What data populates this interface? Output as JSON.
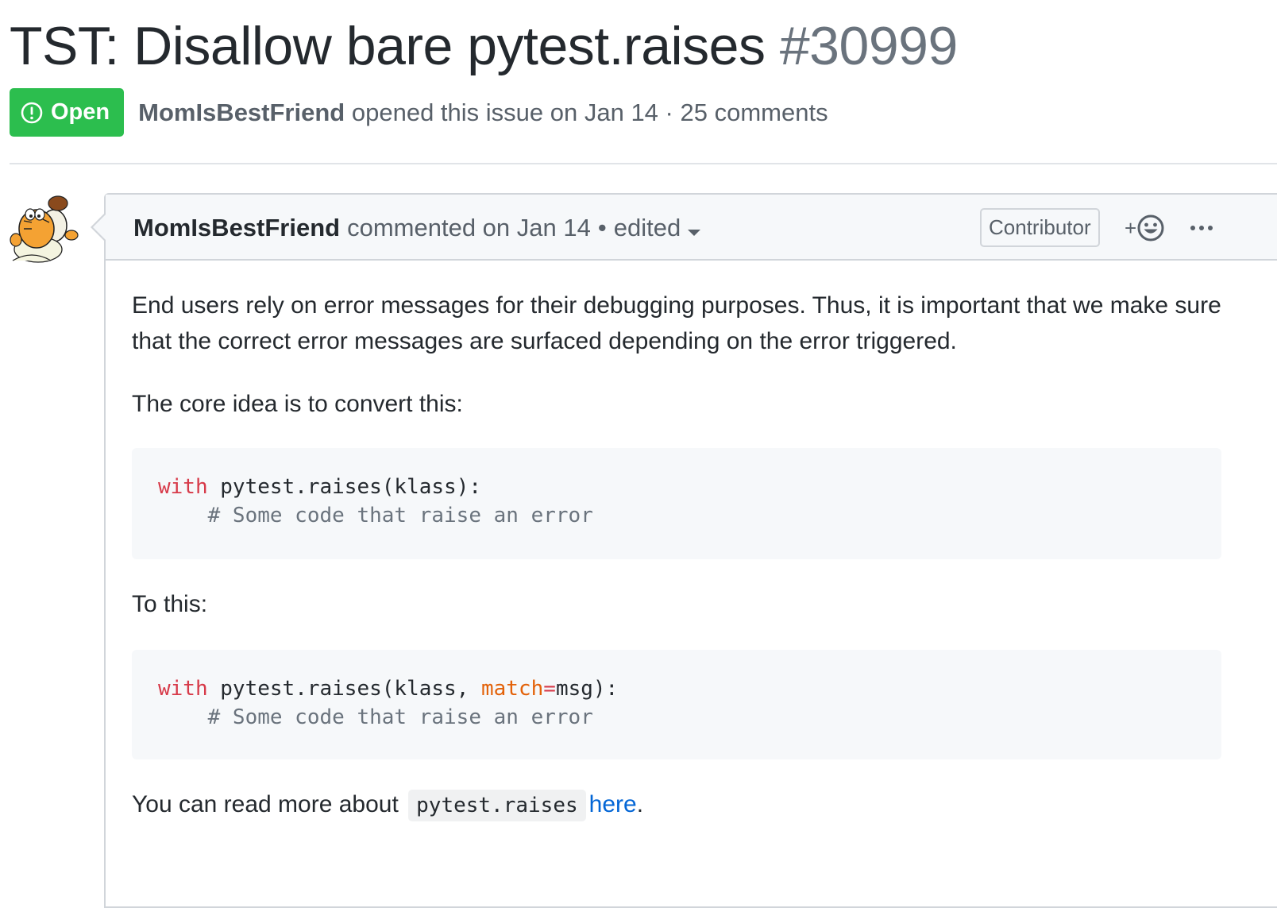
{
  "issue": {
    "title": "TST: Disallow bare pytest.raises",
    "number": "#30999",
    "state": "Open",
    "author": "MomIsBestFriend",
    "opened_text": "opened this issue on Jan 14",
    "separator": "·",
    "comments_count": "25 comments"
  },
  "comment": {
    "author": "MomIsBestFriend",
    "commented_text": "commented on Jan 14",
    "bullet": "•",
    "edited_label": "edited",
    "role_badge": "Contributor",
    "reaction_label": "+",
    "paragraphs": [
      "End users rely on error messages for their debugging purposes. Thus, it is important that we make sure that the correct error messages are surfaced depending on the error triggered.",
      "The core idea is to convert this:",
      "To this:"
    ],
    "code_before": {
      "kw": "with",
      "rest": " pytest.raises(klass):",
      "comment": "    # Some code that raise an error"
    },
    "code_after": {
      "kw": "with",
      "pre": " pytest.raises(klass, ",
      "attr": "match",
      "eq": "=",
      "post": "msg):",
      "comment": "    # Some code that raise an error"
    },
    "footer": {
      "lead": "You can read more about ",
      "inline_code": "pytest.raises",
      "link": "here",
      "trail": "."
    }
  },
  "icons": {
    "state": "issue-opened-icon",
    "reaction": "smiley-icon",
    "more": "kebab-horizontal-icon",
    "dropdown": "triangle-down-icon"
  },
  "colors": {
    "open_green": "#2cbe4e",
    "link_blue": "#0366d6",
    "keyword_red": "#d73a49",
    "param_orange": "#e36209",
    "muted_gray": "#6a737d",
    "code_bg": "#f6f8fa"
  }
}
